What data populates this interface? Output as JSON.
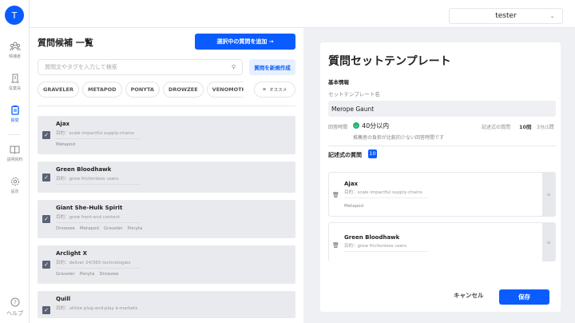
{
  "sidebar": {
    "avatar": "T",
    "items": [
      {
        "label": "候補者"
      },
      {
        "label": "従業員"
      },
      {
        "label": "質問"
      },
      {
        "label": "説明資料"
      },
      {
        "label": "設定"
      }
    ],
    "help": "ヘルプ"
  },
  "header": {
    "user": "tester"
  },
  "left": {
    "title": "質問候補 一覧",
    "add_button": "選択中の質問を追加 →",
    "search_placeholder": "質問文やタグを入力して検索",
    "new_button": "質問を新規作成",
    "chips": [
      "GRAVELER",
      "METAPOD",
      "PONYTA",
      "DROWZEE",
      "VENOMOTH"
    ],
    "sort": "オススメ",
    "questions": [
      {
        "title": "Ajax",
        "purpose": "目的：scale impactful supply-chains",
        "tags": [
          "Metapod"
        ]
      },
      {
        "title": "Green Bloodhawk",
        "purpose": "目的：grow frictionless users",
        "tags": []
      },
      {
        "title": "Giant She-Hulk Spirit",
        "purpose": "目的：grow front-end content",
        "tags": [
          "Drowzee",
          "Metapod",
          "Graveler",
          "Ponyta"
        ]
      },
      {
        "title": "Arclight X",
        "purpose": "目的：deliver 24/365 technologies",
        "tags": [
          "Graveler",
          "Ponyta",
          "Drowzee"
        ]
      },
      {
        "title": "Quill",
        "purpose": "目的：utilize plug-and-play e-markets",
        "tags": []
      }
    ]
  },
  "right": {
    "title": "質問セットテンプレート",
    "basic_info": "基本情報",
    "name_label": "セットテンプレート名",
    "name_value": "Merope Gaunt",
    "time_label": "回答時間",
    "time_value": "40分以内",
    "time_note": "推薦者の負担が比較的少ない回答時間です",
    "written_label": "記述式の質問",
    "written_count": "10問",
    "per_question": "3分/1問",
    "section_title": "記述式の質問",
    "section_count": "10",
    "selected": [
      {
        "title": "Ajax",
        "purpose": "目的：scale impactful supply-chains",
        "tags": "Metapod"
      },
      {
        "title": "Green Bloodhawk",
        "purpose": "目的：grow frictionless users"
      }
    ],
    "cancel": "キャンセル",
    "save": "保存"
  },
  "colors": {
    "accent": "#0a5cff",
    "success": "#22b573"
  }
}
